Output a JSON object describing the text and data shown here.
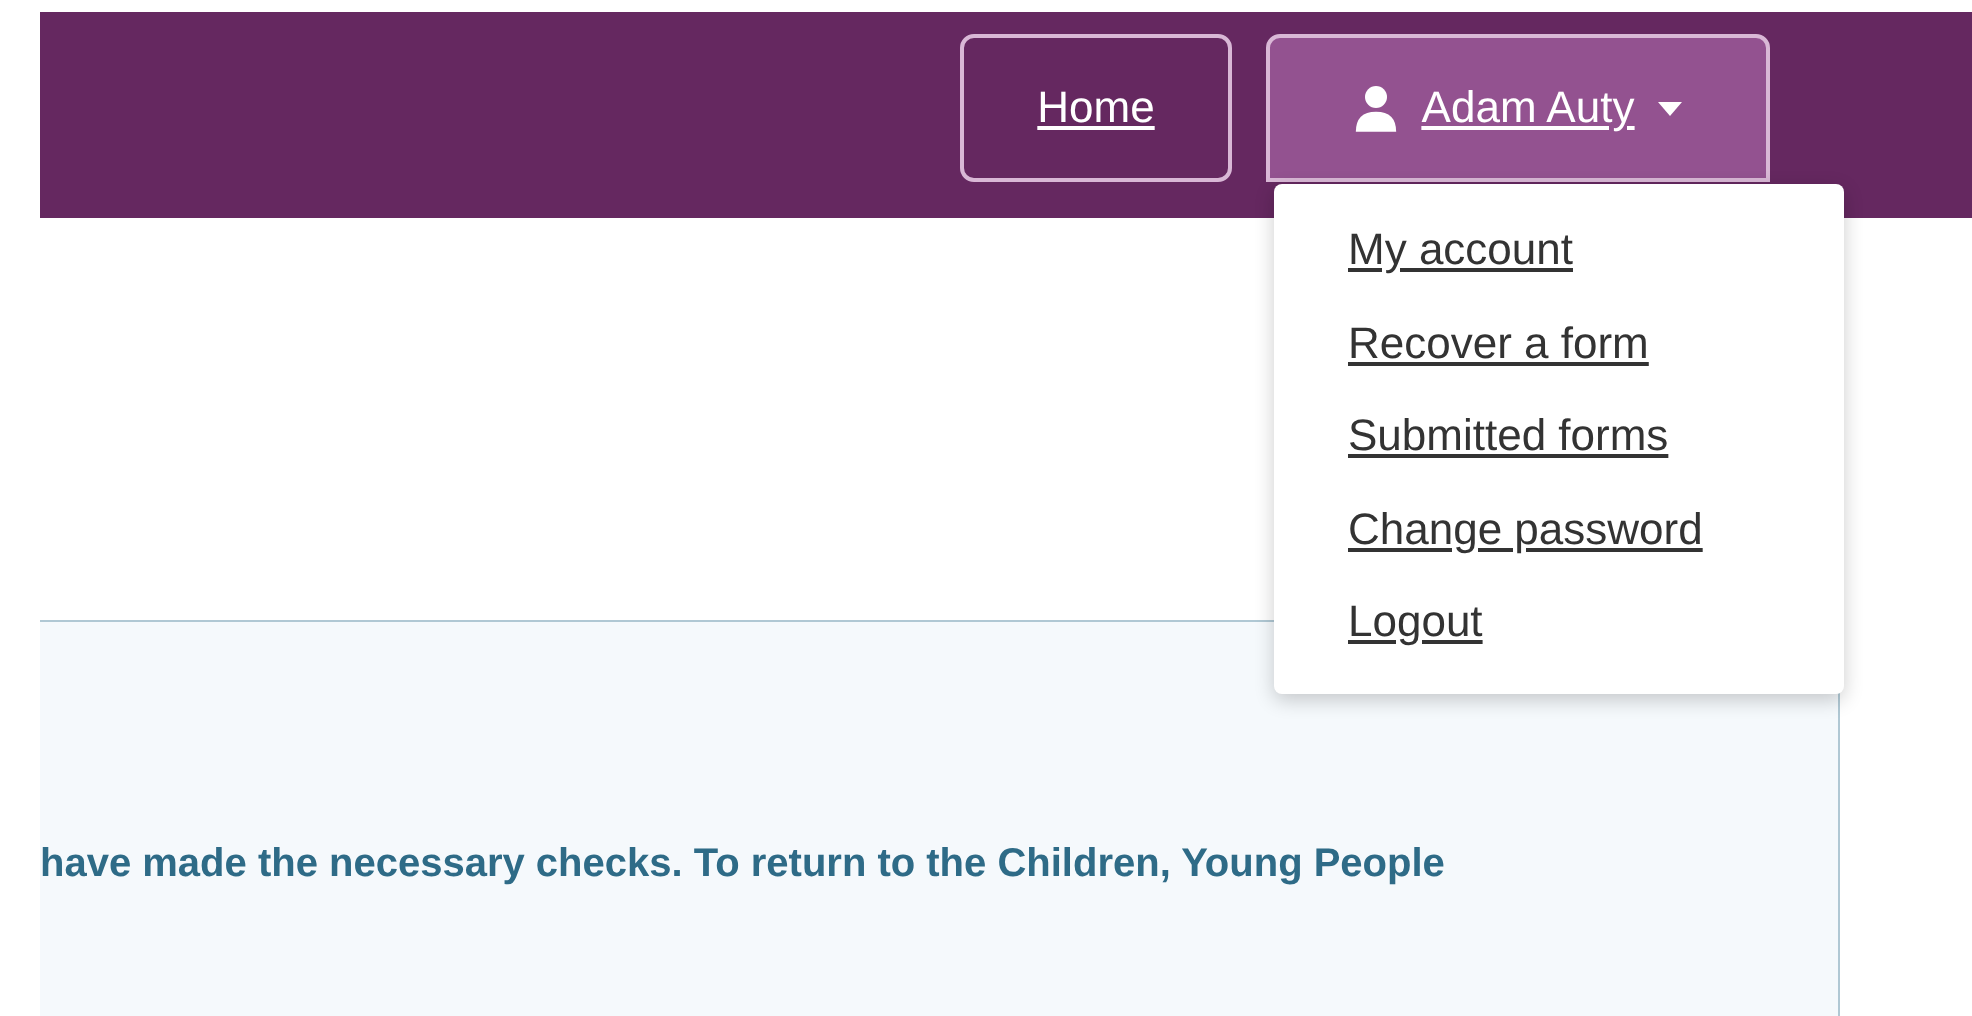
{
  "header": {
    "nav": [
      {
        "label": "Home",
        "kind": "link"
      },
      {
        "label": "Adam Auty",
        "kind": "user-menu",
        "expanded": true
      }
    ]
  },
  "user_menu": {
    "items": [
      "My account",
      "Recover a form",
      "Submitted forms",
      "Change password",
      "Logout"
    ]
  },
  "panel": {
    "text": "have made the necessary checks. To return to the Children, Young People"
  }
}
